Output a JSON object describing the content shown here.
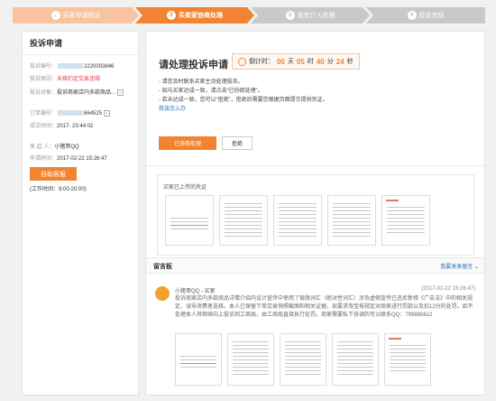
{
  "steps": [
    {
      "num": "✓",
      "label": "买家申请投诉"
    },
    {
      "num": "2",
      "label": "买卖家协商处理"
    },
    {
      "num": "3",
      "label": "淘宝介入处理"
    },
    {
      "num": "4",
      "label": "投诉完结"
    }
  ],
  "left": {
    "title": "投诉申请",
    "complaint_no_label": "投诉编号：",
    "complaint_no": "2220003846",
    "reason_label": "投诉原因：",
    "reason": "未按约定交易违规",
    "target_label": "投诉对象：",
    "target": "投诉商家店内多款商品...",
    "order_label": "订单编号：",
    "order_no": "664525",
    "order_time_label": "成交时间：",
    "order_time": "2017-      23:44:02",
    "initiator_label": "发 起 人：",
    "initiator": "小猪哥QQ",
    "apply_time_label": "申请时间：",
    "apply_time": "2017-02-22 15:26:47",
    "service_button": "自助客服",
    "work_hours": "(工作时间：9:00-20:00)"
  },
  "main": {
    "title": "请处理投诉申请",
    "timer": {
      "prefix": "倒计时：",
      "days": "00",
      "days_unit": "天",
      "hours": "05",
      "hours_unit": "时",
      "minutes": "40",
      "minutes_unit": "分",
      "seconds": "24",
      "seconds_unit": "秒"
    },
    "tips": [
      "- 请您及时联系买家主动处理投诉。",
      "- 如与买家达成一致，请点击“已协商处理”。",
      "- 若未达成一致，您可以“拒绝”，拒绝后需要您根据页面提示提供凭证。"
    ],
    "help_link": "我该怎么办",
    "accept_button": "已协商处理",
    "reject_button": "拒绝",
    "evidence_label": "买家已上传的凭证",
    "board_title": "留言板",
    "board_action": "我要发表留言 ⌄",
    "message": {
      "author": "小猪哥QQ - 买家",
      "time": "(2017-02-22 15:26:47)",
      "text": "投诉商家店内多款商品详情介绍内设计宣传中使用了极限词汇（绝对性词汇）涉及虚假宣传已违反新修《广告法》中的相关规定，误导消费者选择。本人已保留下单交易快照截图和相关证据，现要求淘宝按规定对商家进行罚款以及扣12分的处罚。如不处理本人将继续向上投诉到工商局，由工商局直接执行处罚。商家需要私下协调的可以联系QQ：799880612"
    }
  }
}
